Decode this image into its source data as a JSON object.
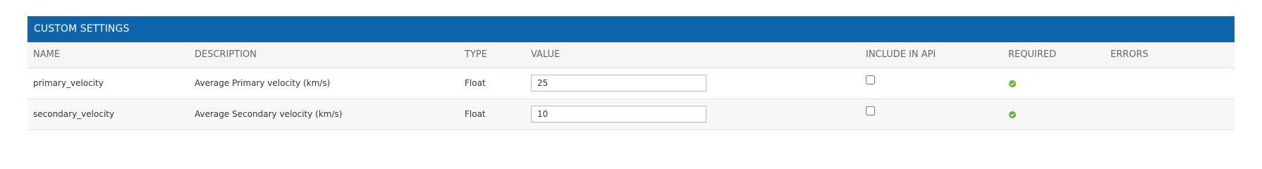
{
  "panel": {
    "title": "CUSTOM SETTINGS"
  },
  "table": {
    "columns": [
      "NAME",
      "DESCRIPTION",
      "TYPE",
      "VALUE",
      "INCLUDE IN API",
      "REQUIRED",
      "ERRORS"
    ],
    "rows": [
      {
        "name": "primary_velocity",
        "description": "Average Primary velocity (km/s)",
        "type": "Float",
        "value": "25",
        "include_in_api": false,
        "required": true,
        "errors": ""
      },
      {
        "name": "secondary_velocity",
        "description": "Average Secondary velocity (km/s)",
        "type": "Float",
        "value": "10",
        "include_in_api": false,
        "required": true,
        "errors": ""
      }
    ]
  },
  "colors": {
    "header_bg": "#0d64ab",
    "required_check": "#5cb531"
  },
  "icons": {
    "required": "check-circle-icon"
  }
}
